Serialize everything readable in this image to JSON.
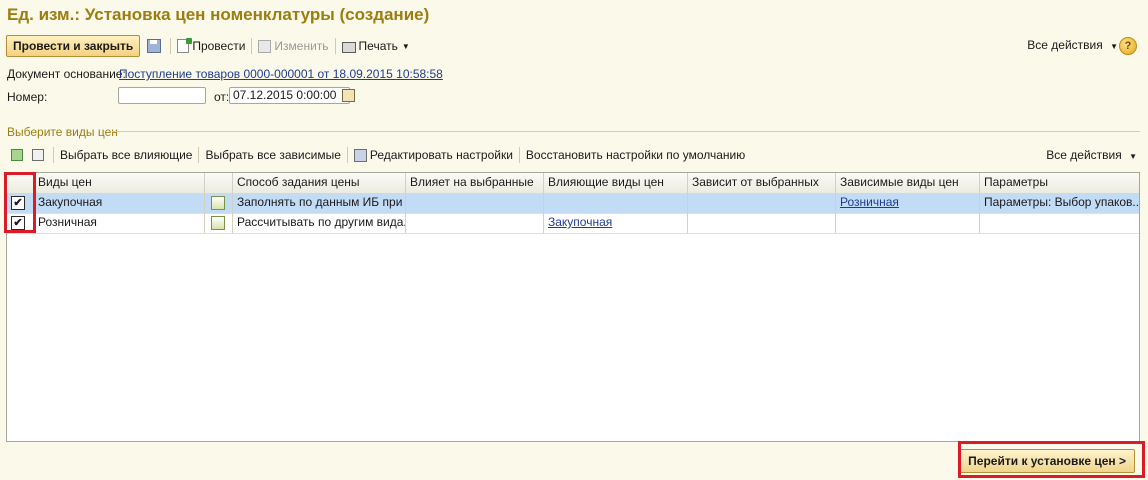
{
  "window": {
    "title": "Ед. изм.: Установка цен номенклатуры (создание)"
  },
  "toolbar": {
    "post_close": "Провести и закрыть",
    "post": "Провести",
    "edit": "Изменить",
    "print": "Печать",
    "all_actions": "Все действия",
    "help_glyph": "?"
  },
  "form": {
    "base_doc_label": "Документ основание:",
    "base_doc_link": "Поступление товаров 0000-000001 от 18.09.2015 10:58:58",
    "number_label": "Номер:",
    "number_value": "",
    "date_label": "от:",
    "date_value": "07.12.2015  0:00:00"
  },
  "group": {
    "title": "Выберите виды цен",
    "select_influencing": "Выбрать все влияющие",
    "select_dependent": "Выбрать все зависимые",
    "edit_settings": "Редактировать настройки",
    "restore_defaults": "Восстановить настройки по умолчанию",
    "all_actions": "Все действия"
  },
  "table": {
    "columns": [
      "",
      "Виды цен",
      "",
      "Способ задания цены",
      "Влияет на выбранные",
      "Влияющие виды цен",
      "Зависит от выбранных",
      "Зависимые виды цен",
      "Параметры"
    ],
    "rows": [
      {
        "checked": "✔",
        "name": "Закупочная",
        "method": "Заполнять по данным ИБ при ...",
        "affects": "",
        "influencing": "",
        "depends": "",
        "dependent": "Розничная",
        "params": "Параметры: Выбор упаков..."
      },
      {
        "checked": "✔",
        "name": "Розничная",
        "method": "Рассчитывать по другим вида...",
        "affects": "",
        "influencing": "Закупочная",
        "depends": "",
        "dependent": "",
        "params": ""
      }
    ]
  },
  "footer": {
    "next_button": "Перейти к установке цен >"
  },
  "colors": {
    "title": "#9c7d11",
    "background": "#fbf9e9",
    "selection": "#c2dcf6",
    "highlight": "#d91c28"
  }
}
